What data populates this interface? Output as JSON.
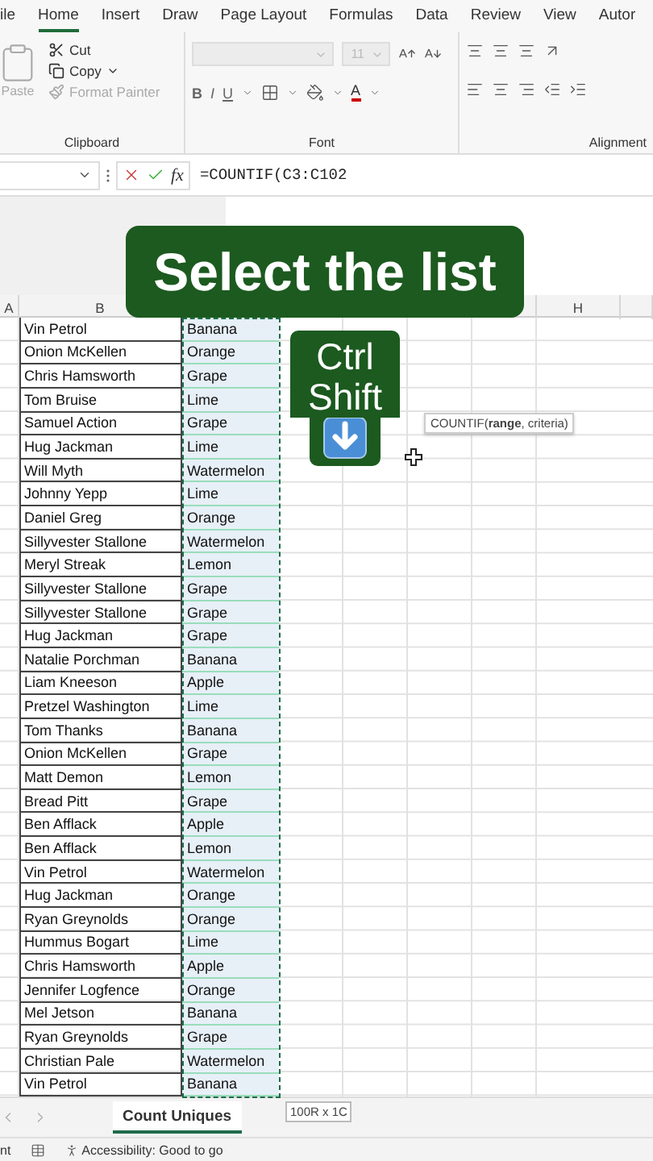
{
  "ribbon_tabs": [
    {
      "label": "ile",
      "selected": false
    },
    {
      "label": "Home",
      "selected": true
    },
    {
      "label": "Insert",
      "selected": false
    },
    {
      "label": "Draw",
      "selected": false
    },
    {
      "label": "Page Layout",
      "selected": false
    },
    {
      "label": "Formulas",
      "selected": false
    },
    {
      "label": "Data",
      "selected": false
    },
    {
      "label": "Review",
      "selected": false
    },
    {
      "label": "View",
      "selected": false
    },
    {
      "label": "Autor",
      "selected": false
    }
  ],
  "clipboard": {
    "group_label": "Clipboard",
    "paste": {
      "label": "Paste",
      "disabled": true
    },
    "cut": {
      "label": "Cut",
      "disabled": false
    },
    "copy": {
      "label": "Copy",
      "disabled": false
    },
    "format_painter": {
      "label": "Format Painter",
      "disabled": true
    }
  },
  "font": {
    "group_label": "Font",
    "font_size": "11",
    "disabled": true,
    "bold": "B",
    "italic": "I",
    "underline": "U",
    "font_color": "A"
  },
  "alignment": {
    "group_label": "Alignment"
  },
  "formula_bar": {
    "function_label": "fx",
    "formula": "=COUNTIF(C3:C102"
  },
  "column_headers": [
    {
      "label": "A"
    },
    {
      "label": "B"
    },
    {
      "label": "H"
    }
  ],
  "rows": [
    {
      "name": "Vin Petrol",
      "fruit": "Banana",
      "selected": true
    },
    {
      "name": "Onion McKellen",
      "fruit": "Orange",
      "selected": true
    },
    {
      "name": "Chris Hamsworth",
      "fruit": "Grape",
      "selected": true
    },
    {
      "name": "Tom Bruise",
      "fruit": "Lime",
      "selected": true
    },
    {
      "name": "Samuel Action",
      "fruit": "Grape",
      "selected": true
    },
    {
      "name": "Hug Jackman",
      "fruit": "Lime",
      "selected": true
    },
    {
      "name": "Will Myth",
      "fruit": "Watermelon",
      "selected": true
    },
    {
      "name": "Johnny Yepp",
      "fruit": "Lime",
      "selected": true
    },
    {
      "name": "Daniel Greg",
      "fruit": "Orange",
      "selected": true
    },
    {
      "name": "Sillyvester Stallone",
      "fruit": "Watermelon",
      "selected": true
    },
    {
      "name": "Meryl Streak",
      "fruit": "Lemon",
      "selected": true
    },
    {
      "name": "Sillyvester Stallone",
      "fruit": "Grape",
      "selected": true
    },
    {
      "name": "Sillyvester Stallone",
      "fruit": "Grape",
      "selected": true
    },
    {
      "name": "Hug Jackman",
      "fruit": "Grape",
      "selected": true
    },
    {
      "name": "Natalie Porchman",
      "fruit": "Banana",
      "selected": true
    },
    {
      "name": "Liam Kneeson",
      "fruit": "Apple",
      "selected": true
    },
    {
      "name": "Pretzel Washington",
      "fruit": "Lime",
      "selected": true
    },
    {
      "name": "Tom Thanks",
      "fruit": "Banana",
      "selected": true
    },
    {
      "name": "Onion McKellen",
      "fruit": "Grape",
      "selected": true
    },
    {
      "name": "Matt Demon",
      "fruit": "Lemon",
      "selected": true
    },
    {
      "name": "Bread Pitt",
      "fruit": "Grape",
      "selected": true
    },
    {
      "name": "Ben Afflack",
      "fruit": "Apple",
      "selected": true
    },
    {
      "name": "Ben Afflack",
      "fruit": "Lemon",
      "selected": true
    },
    {
      "name": "Vin Petrol",
      "fruit": "Watermelon",
      "selected": true
    },
    {
      "name": "Hug Jackman",
      "fruit": "Orange",
      "selected": true
    },
    {
      "name": "Ryan Greynolds",
      "fruit": "Orange",
      "selected": true
    },
    {
      "name": "Hummus Bogart",
      "fruit": "Lime",
      "selected": true
    },
    {
      "name": "Chris Hamsworth",
      "fruit": "Apple",
      "selected": true
    },
    {
      "name": "Jennifer Logfence",
      "fruit": "Orange",
      "selected": true
    },
    {
      "name": "Mel Jetson",
      "fruit": "Banana",
      "selected": true
    },
    {
      "name": "Ryan Greynolds",
      "fruit": "Grape",
      "selected": true
    },
    {
      "name": "Christian Pale",
      "fruit": "Watermelon",
      "selected": true
    },
    {
      "name": "Vin Petrol",
      "fruit": "Banana",
      "selected": true
    }
  ],
  "caption": "Select the list",
  "key_hint": [
    "Ctrl",
    "Shift"
  ],
  "function_tooltip": "COUNTIF(**range**, criteria)",
  "selection_size": "100R x 1C",
  "sheet_tabs": [
    {
      "label": "Count Uniques",
      "selected": true
    }
  ],
  "status_bar": {
    "mode": "nt",
    "accessibility": "Accessibility: Good to go"
  }
}
